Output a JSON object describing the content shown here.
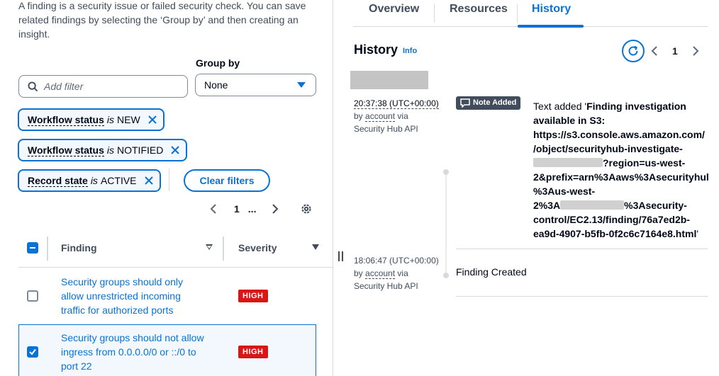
{
  "left_panel": {
    "intro_text": "A finding is a security issue or failed security check. You can save related findings by selecting the ‘Group by’ and then creating an insight.",
    "filter_placeholder": "Add filter",
    "group_by_label": "Group by",
    "group_by_value": "None",
    "filter_tokens": [
      {
        "key": "Workflow status",
        "op": "is",
        "value": "NEW"
      },
      {
        "key": "Workflow status",
        "op": "is",
        "value": "NOTIFIED"
      },
      {
        "key": "Record state",
        "op": "is",
        "value": "ACTIVE"
      }
    ],
    "clear_filters_label": "Clear filters",
    "pagination": {
      "current_page": "1",
      "ellipsis": "..."
    },
    "table": {
      "columns": [
        "Finding",
        "Severity"
      ],
      "rows": [
        {
          "title_lines": [
            "Security groups should only",
            "allow unrestricted incoming",
            "traffic for authorized ports"
          ],
          "severity": "HIGH",
          "selected": false
        },
        {
          "title_lines": [
            "Security groups should not allow",
            "ingress from 0.0.0.0/0 or ::/0 to",
            "port 22"
          ],
          "severity": "HIGH",
          "selected": true
        }
      ]
    }
  },
  "right_panel": {
    "tabs": [
      "Overview",
      "Resources",
      "History"
    ],
    "active_tab": "History",
    "history_title": "History",
    "info_label": "Info",
    "current_page": "1",
    "events": [
      {
        "time": "20:37:38 (UTC+00:00)",
        "by_prefix": "by",
        "by_account": "account",
        "via": "via",
        "source": "Security Hub API",
        "badge": "Note Added",
        "text_prefix": "Text added '",
        "text_lines": [
          "Finding investigation",
          "available in S3:",
          "https://s3.console.aws.amazon.com/",
          "/object/securityhub-investigate-",
          "?region=us-west-",
          "2&prefix=arn%3Aaws%3Asecurityhul",
          "%3Aus-west-",
          "%3Asecurity-",
          "control/EC2.13/finding/76a7ed2b-",
          "ea9d-4907-b5fb-0f2c6c7164e8.html"
        ],
        "line8_prefix": "2%3A",
        "text_suffix": "'"
      },
      {
        "time": "18:06:47 (UTC+00:00)",
        "by_prefix": "by",
        "by_account": "account",
        "via": "via",
        "source": "Security Hub API",
        "description": "Finding Created"
      }
    ]
  },
  "colors": {
    "accent": "#0972d3",
    "high_severity": "#d91515",
    "note_badge": "#414d5c"
  }
}
